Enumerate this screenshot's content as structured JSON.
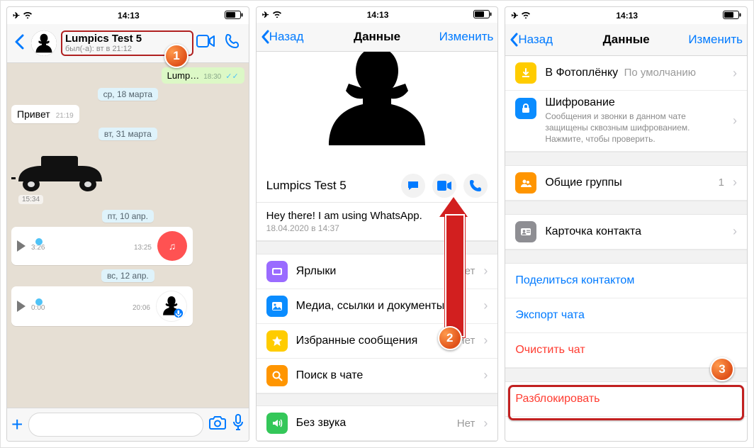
{
  "status": {
    "time": "14:13"
  },
  "chat": {
    "contact_name": "Lumpics Test 5",
    "last_seen": "был(-а): вт в 21:12",
    "msg_out_text": "Lump…",
    "msg_out_time": "18:30",
    "date1": "ср, 18 марта",
    "msg_in_text": "Привет",
    "msg_in_time": "21:19",
    "date2": "вт, 31 марта",
    "sticker_time": "15:34",
    "date3": "пт, 10 апр.",
    "voice1_cur": "3:26",
    "voice1_end": "13:25",
    "date4": "вс, 12 апр.",
    "voice2_cur": "0:00",
    "voice2_end": "20:06"
  },
  "profile": {
    "back": "Назад",
    "title": "Данные",
    "edit": "Изменить",
    "name": "Lumpics Test 5",
    "status_text": "Hey there! I am using WhatsApp.",
    "status_date": "18.04.2020 в 14:37",
    "shortcuts": "Ярлыки",
    "shortcuts_val": "Нет",
    "media": "Медиа, ссылки и документы",
    "starred": "Избранные сообщения",
    "starred_val": "Нет",
    "search": "Поиск в чате",
    "mute": "Без звука",
    "mute_val": "Нет"
  },
  "profile2": {
    "back": "Назад",
    "title": "Данные",
    "edit": "Изменить",
    "cameraroll": "В Фотоплёнку",
    "cameraroll_val": "По умолчанию",
    "encryption": "Шифрование",
    "encryption_desc": "Сообщения и звонки в данном чате защищены сквозным шифрованием. Нажмите, чтобы проверить.",
    "groups": "Общие группы",
    "groups_val": "1",
    "contactcard": "Карточка контакта",
    "share": "Поделиться контактом",
    "export": "Экспорт чата",
    "clear": "Очистить чат",
    "unblock": "Разблокировать"
  },
  "callouts": {
    "one": "1",
    "two": "2",
    "three": "3"
  }
}
